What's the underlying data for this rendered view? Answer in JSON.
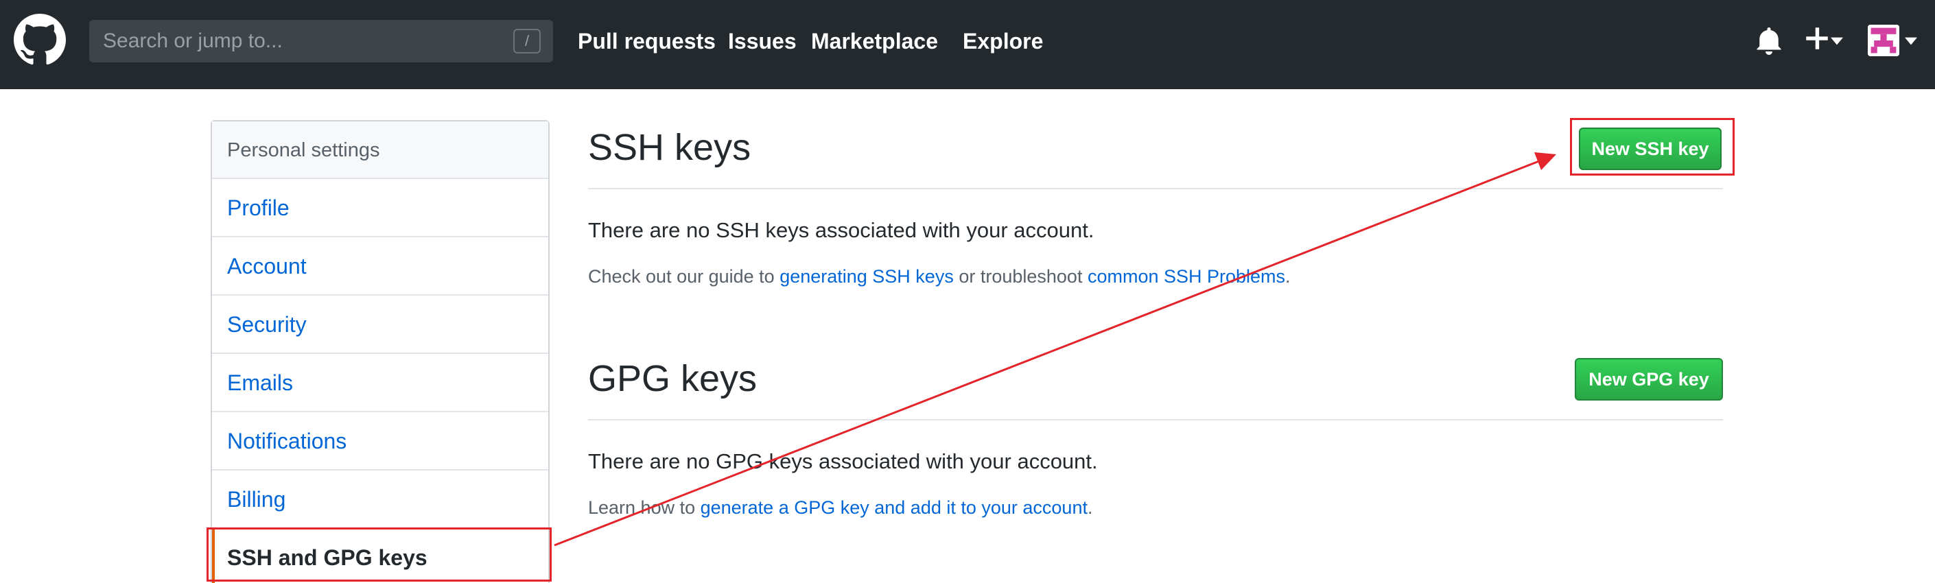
{
  "header": {
    "search_placeholder": "Search or jump to...",
    "search_shortcut": "/",
    "nav": {
      "pull_requests": "Pull requests",
      "issues": "Issues",
      "marketplace": "Marketplace",
      "explore": "Explore"
    },
    "icons": [
      "github-logo-icon",
      "bell-icon",
      "plus-icon",
      "chevron-down-icon",
      "avatar"
    ]
  },
  "sidebar": {
    "heading": "Personal settings",
    "items": [
      {
        "label": "Profile"
      },
      {
        "label": "Account"
      },
      {
        "label": "Security"
      },
      {
        "label": "Emails"
      },
      {
        "label": "Notifications"
      },
      {
        "label": "Billing"
      },
      {
        "label": "SSH and GPG keys",
        "selected": true
      }
    ]
  },
  "ssh": {
    "title": "SSH keys",
    "button_label": "New SSH key",
    "empty_text": "There are no SSH keys associated with your account.",
    "help_prefix": "Check out our guide to ",
    "help_link1": "generating SSH keys",
    "help_middle": " or troubleshoot ",
    "help_link2": "common SSH Problems",
    "help_suffix": "."
  },
  "gpg": {
    "title": "GPG keys",
    "button_label": "New GPG key",
    "empty_text": "There are no GPG keys associated with your account.",
    "help_prefix": "Learn how to ",
    "help_link": "generate a GPG key and add it to your account",
    "help_suffix": "."
  },
  "colors": {
    "header_bg": "#24292e",
    "link": "#0366d6",
    "button_green": "#28a745",
    "annotation_red": "#e3242b"
  }
}
